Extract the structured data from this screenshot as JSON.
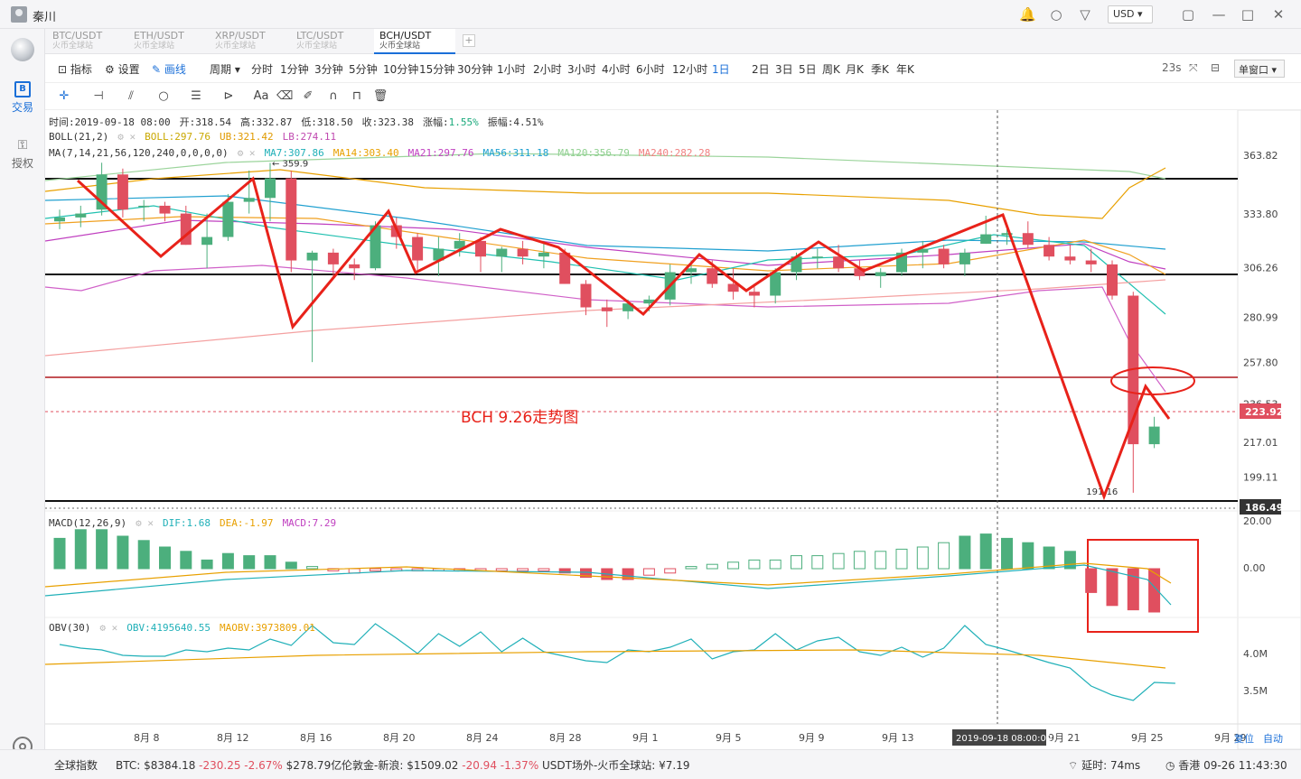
{
  "titlebar": {
    "user_name": "秦川",
    "currency": "USD",
    "icons": [
      "bell-icon",
      "search-icon",
      "shirt-icon",
      "expand-icon",
      "minimize-icon",
      "maximize-icon",
      "close-icon"
    ]
  },
  "leftnav": {
    "trade_label": "交易",
    "auth_label": "授权"
  },
  "symbol_tabs": [
    {
      "pair": "BTC/USDT",
      "exchange": "火币全球站"
    },
    {
      "pair": "ETH/USDT",
      "exchange": "火币全球站"
    },
    {
      "pair": "XRP/USDT",
      "exchange": "火币全球站"
    },
    {
      "pair": "LTC/USDT",
      "exchange": "火币全球站"
    },
    {
      "pair": "BCH/USDT",
      "exchange": "火币全球站",
      "active": true
    }
  ],
  "toolbar": {
    "indicator": "指标",
    "settings": "设置",
    "draw": "画线",
    "period_label": "周期",
    "periods": [
      "分时",
      "1分钟",
      "3分钟",
      "5分钟",
      "10分钟",
      "15分钟",
      "30分钟",
      "1小时",
      "2小时",
      "3小时",
      "4小时",
      "6小时",
      "12小时",
      "1日",
      "2日",
      "3日",
      "5日",
      "周K",
      "月K",
      "季K",
      "年K"
    ],
    "active_period": "1日",
    "countdown": "23s",
    "window_mode": "单窗口"
  },
  "info": {
    "time": "时间:2019-09-18 08:00",
    "open": "开:318.54",
    "high": "高:332.87",
    "low": "低:318.50",
    "close": "收:323.38",
    "change": "涨幅:",
    "change_val": "1.55%",
    "amplitude": "振幅:4.51%"
  },
  "boll": {
    "label": "BOLL(21,2)",
    "boll": "BOLL:297.76",
    "ub": "UB:321.42",
    "lb": "LB:274.11"
  },
  "ma": {
    "label": "MA(7,14,21,56,120,240,0,0,0,0)",
    "ma7": "MA7:307.86",
    "ma14": "MA14:303.40",
    "ma21": "MA21:297.76",
    "ma56": "MA56:311.18",
    "ma120": "MA120:356.79",
    "ma240": "MA240:282.28"
  },
  "macd": {
    "label": "MACD(12,26,9)",
    "dif": "DIF:1.68",
    "dea": "DEA:-1.97",
    "macd": "MACD:7.29"
  },
  "obv": {
    "label": "OBV(30)",
    "obv": "OBV:4195640.55",
    "maobv": "MAOBV:3973809.01"
  },
  "annotation_title": "BCH 9.26走势图",
  "max_label": "← 359.9",
  "min_label": "191.16",
  "price_axis": [
    "363.82",
    "333.80",
    "306.26",
    "280.99",
    "257.80",
    "236.53",
    "217.01",
    "199.11"
  ],
  "current_price": "223.92",
  "hline_price": "186.49",
  "macd_axis": [
    "20.00",
    "0.00"
  ],
  "obv_axis": [
    "4.0M",
    "3.5M"
  ],
  "date_axis": [
    "8月 8",
    "8月 12",
    "8月 16",
    "8月 20",
    "8月 24",
    "8月 28",
    "9月 1",
    "9月 5",
    "9月 9",
    "9月 13",
    "9月 17",
    "9月 21",
    "9月 25",
    "9月 29"
  ],
  "crosshair_time": "2019-09-18 08:00:00",
  "axis_actions": {
    "reset": "复位",
    "auto": "自动"
  },
  "colors": {
    "up": "#4caf7d",
    "down": "#e04f5f",
    "accent": "#1a6fd8",
    "arrow": "#e8221a"
  },
  "chart_data": {
    "type": "candlestick",
    "dates": [
      "8/5",
      "8/6",
      "8/7",
      "8/8",
      "8/9",
      "8/10",
      "8/11",
      "8/12",
      "8/13",
      "8/14",
      "8/15",
      "8/16",
      "8/17",
      "8/18",
      "8/19",
      "8/20",
      "8/21",
      "8/22",
      "8/23",
      "8/24",
      "8/25",
      "8/26",
      "8/27",
      "8/28",
      "8/29",
      "8/30",
      "8/31",
      "9/1",
      "9/2",
      "9/3",
      "9/4",
      "9/5",
      "9/6",
      "9/7",
      "9/8",
      "9/9",
      "9/10",
      "9/11",
      "9/12",
      "9/13",
      "9/14",
      "9/15",
      "9/16",
      "9/17",
      "9/18",
      "9/19",
      "9/20",
      "9/21",
      "9/22",
      "9/23",
      "9/24",
      "9/25",
      "9/26"
    ],
    "ohlc": [
      [
        330,
        336,
        326,
        332
      ],
      [
        332,
        338,
        327,
        334
      ],
      [
        336,
        360,
        333,
        354
      ],
      [
        354,
        357,
        332,
        336
      ],
      [
        338,
        341,
        330,
        338
      ],
      [
        338,
        340,
        330,
        334
      ],
      [
        334,
        338,
        318,
        318
      ],
      [
        318,
        334,
        306,
        322
      ],
      [
        322,
        344,
        320,
        340
      ],
      [
        340,
        356,
        334,
        342
      ],
      [
        342,
        359.9,
        330,
        352
      ],
      [
        352,
        356,
        304,
        310
      ],
      [
        310,
        315,
        258,
        314
      ],
      [
        314,
        316,
        302,
        308
      ],
      [
        308,
        311,
        300,
        306
      ],
      [
        306,
        330,
        305,
        328
      ],
      [
        328,
        332,
        316,
        322
      ],
      [
        322,
        324,
        304,
        310
      ],
      [
        310,
        322,
        302,
        316
      ],
      [
        316,
        324,
        312,
        320
      ],
      [
        320,
        322,
        304,
        312
      ],
      [
        312,
        317,
        304,
        316
      ],
      [
        316,
        320,
        308,
        312
      ],
      [
        312,
        320,
        306,
        314
      ],
      [
        314,
        316,
        298,
        298
      ],
      [
        298,
        300,
        282,
        286
      ],
      [
        286,
        290,
        276,
        284
      ],
      [
        284,
        290,
        280,
        288
      ],
      [
        288,
        292,
        284,
        290
      ],
      [
        290,
        308,
        287,
        304
      ],
      [
        304,
        310,
        298,
        306
      ],
      [
        306,
        310,
        296,
        298
      ],
      [
        298,
        306,
        290,
        294
      ],
      [
        294,
        298,
        286,
        292
      ],
      [
        292,
        306,
        288,
        304
      ],
      [
        304,
        314,
        300,
        312
      ],
      [
        312,
        316,
        306,
        312
      ],
      [
        312,
        318,
        304,
        306
      ],
      [
        306,
        310,
        300,
        302
      ],
      [
        302,
        306,
        296,
        304
      ],
      [
        304,
        316,
        302,
        314
      ],
      [
        314,
        320,
        306,
        316
      ],
      [
        316,
        318,
        306,
        308
      ],
      [
        308,
        316,
        302,
        314
      ],
      [
        318.54,
        332.87,
        318.5,
        323.38
      ],
      [
        323,
        326,
        318,
        324
      ],
      [
        324,
        330,
        316,
        318
      ],
      [
        318,
        322,
        310,
        312
      ],
      [
        312,
        318,
        308,
        310
      ],
      [
        310,
        316,
        304,
        308
      ],
      [
        308,
        310,
        290,
        292
      ],
      [
        292,
        294,
        191.16,
        216
      ],
      [
        216,
        230,
        214,
        225
      ]
    ],
    "price_range": [
      186.49,
      363.82
    ],
    "macd_hist": [
      14,
      18,
      18,
      15,
      13,
      10,
      8,
      4,
      7,
      6,
      6,
      3,
      1,
      -1,
      -2,
      -1,
      -1,
      -1,
      -1,
      -1,
      -1,
      -1,
      -1,
      -1,
      -2,
      -4,
      -5,
      -5,
      -3,
      -2,
      1,
      2,
      3,
      4,
      4,
      6,
      6,
      7,
      8,
      8,
      9,
      10,
      12,
      15,
      16,
      14,
      12,
      10,
      8,
      -11,
      -17,
      -19,
      -20
    ],
    "obv": [
      3.98,
      3.94,
      3.92,
      3.86,
      3.85,
      3.85,
      3.92,
      3.9,
      3.94,
      3.92,
      4.04,
      3.97,
      4.19,
      4.0,
      3.98,
      4.21,
      4.05,
      3.88,
      4.1,
      3.96,
      4.12,
      3.9,
      4.05,
      3.9,
      3.85,
      3.8,
      3.78,
      3.92,
      3.9,
      3.95,
      4.04,
      3.82,
      3.9,
      3.92,
      4.1,
      3.92,
      4.02,
      4.06,
      3.9,
      3.86,
      3.95,
      3.84,
      3.94,
      4.19,
      3.98,
      3.92,
      3.85,
      3.78,
      3.72,
      3.52,
      3.42,
      3.36,
      3.56,
      3.55
    ]
  }
}
